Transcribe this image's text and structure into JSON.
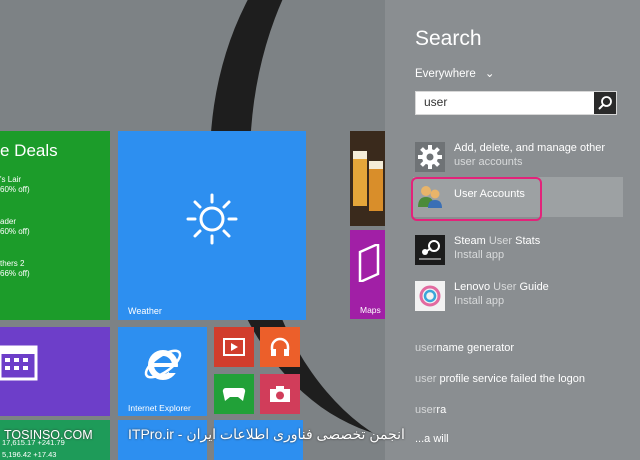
{
  "start": {
    "deals_tile": {
      "title": "e Deals",
      "lines": [
        "'s Lair",
        "60% off)",
        "ader",
        "60% off)",
        "thers 2",
        "66% off)"
      ]
    },
    "weather_tile": {
      "label": "Weather"
    },
    "ie_tile": {
      "label": "Internet Explorer"
    },
    "maps_tile": {
      "label": "Maps"
    },
    "stock_line1": "17,615.17 +241.79",
    "stock_line2": "5,196.42 +17.43"
  },
  "search": {
    "title": "Search",
    "scope": "Everywhere",
    "query": "user",
    "results": [
      {
        "name": "Add, delete, and manage other",
        "sub": "user accounts",
        "icon": "gear-icon"
      },
      {
        "name": "User Accounts",
        "sub": "",
        "icon": "users-icon"
      },
      {
        "name_pre": "Steam ",
        "name_match": "User",
        "name_post": " Stats",
        "sub": "Install app",
        "icon": "steam-icon"
      },
      {
        "name_pre": "Lenovo ",
        "name_match": "User",
        "name_post": " Guide",
        "sub": "Install app",
        "icon": "lenovo-icon"
      }
    ],
    "suggestions": [
      {
        "match": "user",
        "rest": "name generator"
      },
      {
        "match": "user",
        "rest": " profile service failed the logon"
      },
      {
        "match": "user",
        "rest": "ra"
      },
      {
        "match": "",
        "rest": "...a will"
      }
    ]
  },
  "watermark": {
    "left": "TOSINSO.COM",
    "right": "ITPro.ir - انجمن تخصصی فناوری اطلاعات ایران"
  },
  "colors": {
    "deals": "#1c9c2a",
    "weather": "#2d8ff0",
    "maps": "#a11fa6",
    "calendar": "#6d3ec9",
    "highlight": "#e3237a"
  }
}
